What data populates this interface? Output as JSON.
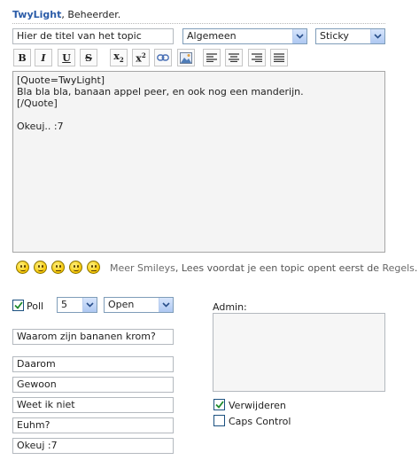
{
  "header": {
    "username": "TwyLight",
    "suffix": ", Beheerder."
  },
  "topic": {
    "title_value": "Hier de titel van het topic",
    "category_value": "Algemeen",
    "type_value": "Sticky"
  },
  "toolbar": {
    "bold": "B",
    "italic": "I",
    "underline": "U",
    "strike": "S",
    "subscript_base": "x",
    "subscript_sub": "2",
    "superscript_base": "x",
    "superscript_sup": "2",
    "icons": [
      "link-icon",
      "image-icon",
      "align-left-icon",
      "align-center-icon",
      "align-right-icon",
      "align-justify-icon"
    ]
  },
  "editor": {
    "lines": [
      "[Quote=TwyLight]",
      "Bla bla bla, banaan appel peer, en ook nog een manderijn.",
      "[/Quote]",
      "",
      "Okeuj.. :7"
    ]
  },
  "smileys": {
    "icons": [
      "smile",
      "smile",
      "neutral",
      "smile",
      "neutral"
    ],
    "more_link": "Meer Smileys",
    "notice_prefix": ", Lees voordat je een topic opent eerst de ",
    "rules_link": "Regels",
    "notice_suffix": "."
  },
  "poll": {
    "checkbox_checked": true,
    "label": "Poll",
    "count_value": "5",
    "status_value": "Open",
    "question": "Waarom zijn bananen krom?",
    "options": [
      "Daarom",
      "Gewoon",
      "Weet ik niet",
      "Euhm?",
      "Okeuj :7"
    ]
  },
  "admin": {
    "label": "Admin:",
    "delete_label": "Verwijderen",
    "delete_checked": true,
    "caps_label": "Caps Control",
    "caps_checked": false
  },
  "colors": {
    "username": "#2b5ca8",
    "select_border": "#7f9db9",
    "checkbox_border": "#1c5180",
    "check_mark": "#1f8a2c"
  }
}
